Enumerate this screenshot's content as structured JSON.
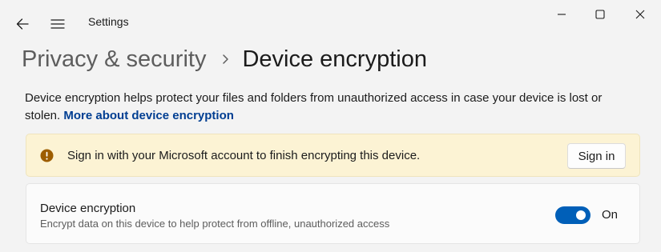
{
  "window": {
    "app_title": "Settings",
    "controls": [
      "minimize-icon",
      "maximize-icon",
      "close-icon"
    ]
  },
  "nav": {
    "back_icon": "arrow-left-icon",
    "menu_icon": "hamburger-icon"
  },
  "breadcrumb": {
    "parent": "Privacy & security",
    "separator_icon": "chevron-right-icon",
    "current": "Device encryption"
  },
  "description": {
    "text": "Device encryption helps protect your files and folders from unauthorized access in case your device is lost or stolen.",
    "link": "More about device encryption"
  },
  "warning": {
    "icon": "warning-circle-icon",
    "message": "Sign in with your Microsoft account to finish encrypting this device.",
    "button_label": "Sign in"
  },
  "setting": {
    "title": "Device encryption",
    "description": "Encrypt data on this device to help protect from offline, unauthorized access",
    "toggle_on": true,
    "toggle_label": "On"
  },
  "colors": {
    "accent": "#005fb8",
    "link": "#003e92",
    "warning_bg": "#fcf3d4",
    "warning_icon": "#9d5d00",
    "background": "#f3f3f3"
  }
}
